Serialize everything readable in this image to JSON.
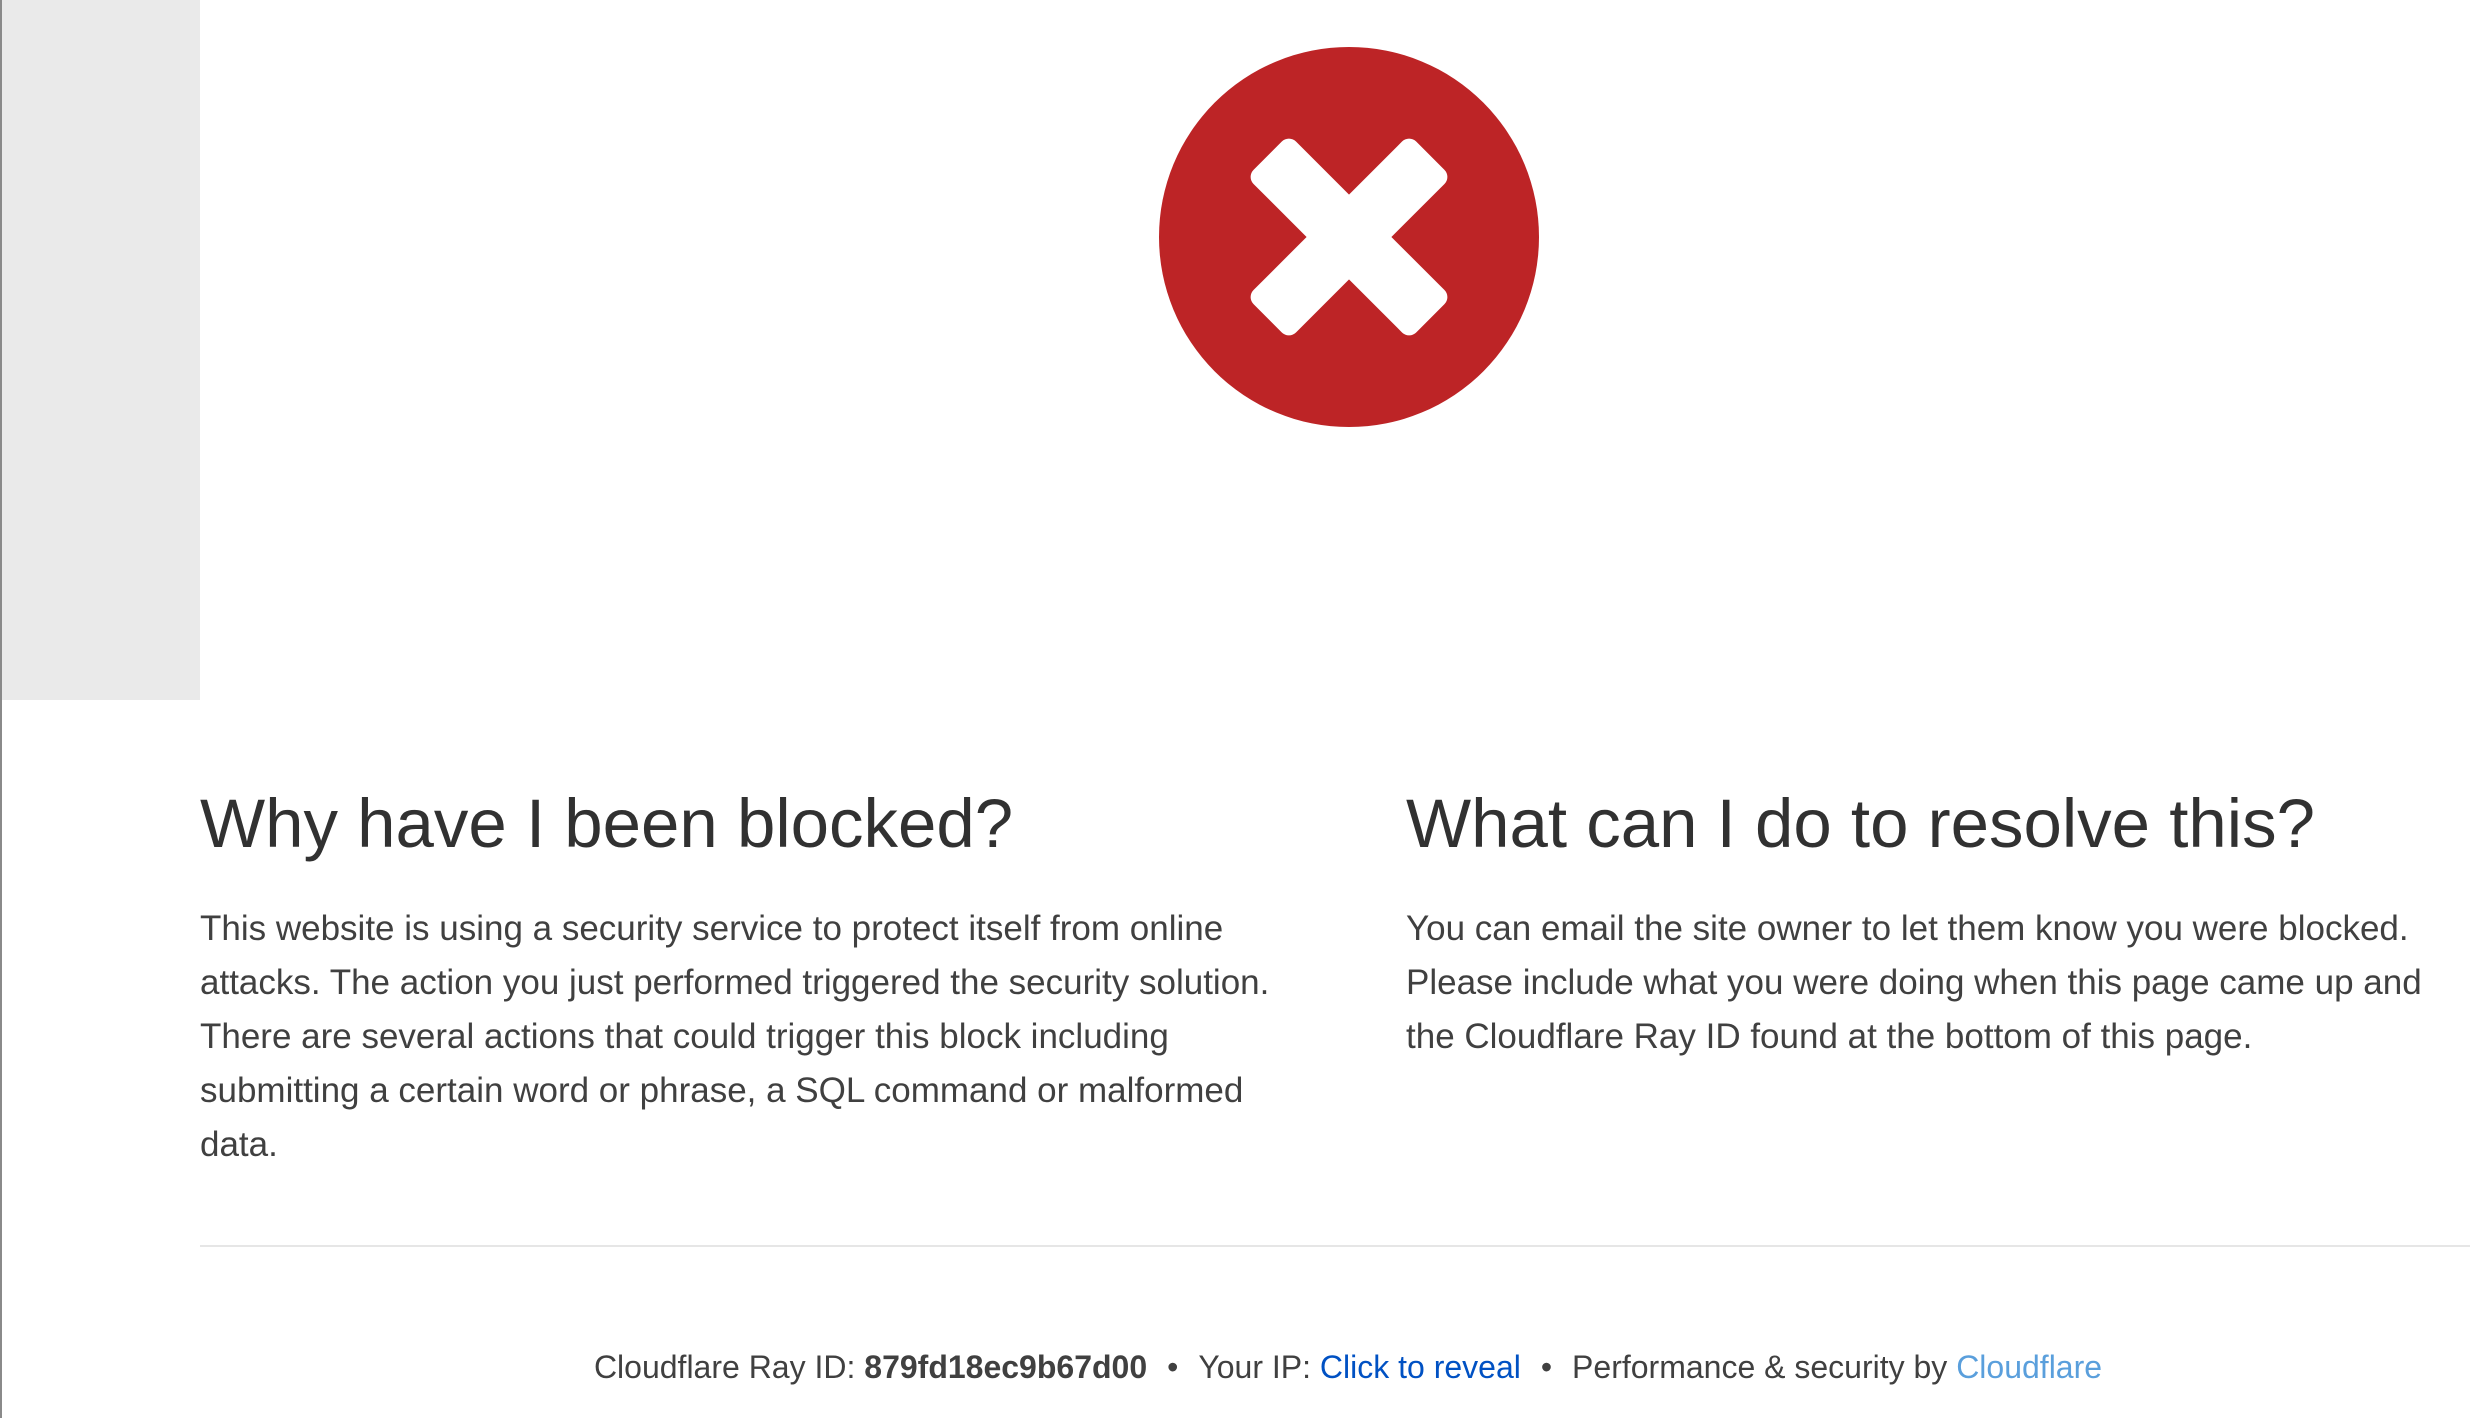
{
  "colors": {
    "error_red": "#bd2426",
    "link_blue": "#0051c3",
    "brand_link": "#5a9fdc"
  },
  "hero": {
    "icon": "error-x-circle-icon"
  },
  "why_blocked": {
    "heading": "Why have I been blocked?",
    "body": "This website is using a security service to protect itself from online attacks. The action you just performed triggered the security solution. There are several actions that could trigger this block including submitting a certain word or phrase, a SQL command or malformed data."
  },
  "resolve": {
    "heading": "What can I do to resolve this?",
    "body_line1": "You can email the site owner to let them know you were blocked.",
    "body_line2": "Please include what you were doing when this page came up and",
    "body_line3": "the Cloudflare Ray ID found at the bottom of this page."
  },
  "footer": {
    "ray_label": "Cloudflare Ray ID: ",
    "ray_id": "879fd18ec9b67d00",
    "separator": "•",
    "ip_label": "Your IP: ",
    "ip_action": "Click to reveal",
    "perf_label": "Performance & security by ",
    "brand": "Cloudflare"
  }
}
